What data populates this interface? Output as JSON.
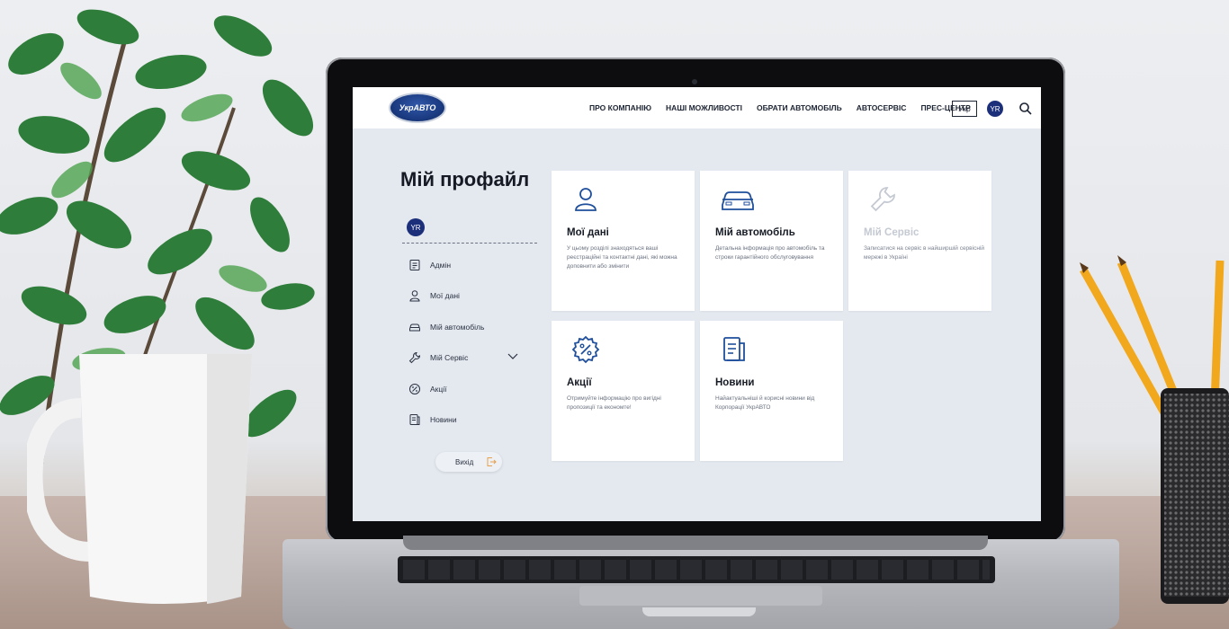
{
  "logo": {
    "text": "УкрАВТО"
  },
  "nav": {
    "items": [
      "ПРО КОМПАНІЮ",
      "НАШІ МОЖЛИВОСТІ",
      "ОБРАТИ АВТОМОБІЛЬ",
      "АВТОСЕРВІС",
      "ПРЕС-ЦЕНТР"
    ]
  },
  "header": {
    "lang": "Укр",
    "avatar": "YR"
  },
  "profile": {
    "title": "Мій профайл",
    "avatar": "YR",
    "menu": [
      {
        "label": "Адмін",
        "icon": "document-icon"
      },
      {
        "label": "Мої дані",
        "icon": "user-icon"
      },
      {
        "label": "Мій автомобіль",
        "icon": "car-icon"
      },
      {
        "label": "Мій Сервіс",
        "icon": "wrench-icon"
      },
      {
        "label": "Акції",
        "icon": "percent-icon"
      },
      {
        "label": "Новини",
        "icon": "news-icon"
      }
    ],
    "exit_label": "Вихід"
  },
  "cards": [
    {
      "title": "Мої дані",
      "desc": "У цьому розділі знаходяться ваші реєстраційні та контактні дані, які можна доповнити або змінити",
      "icon": "user-icon"
    },
    {
      "title": "Мій автомобіль",
      "desc": "Детальна інформація про автомобіль та строки гарантійного обслуговування",
      "icon": "car-icon"
    },
    {
      "title": "Мій Сервіс",
      "desc": "Записатися на сервіс в найширшій сервісній мережі в Україні",
      "icon": "wrench-icon"
    },
    {
      "title": "Акції",
      "desc": "Отримуйте інформацію про вигідні пропозиції та економте!",
      "icon": "percent-icon"
    },
    {
      "title": "Новини",
      "desc": "Найактуальніші й корисні новини від Корпорації УкрАВТО",
      "icon": "news-icon"
    }
  ],
  "colors": {
    "accent": "#1c2f7a",
    "icon_blue": "#1f4f9c",
    "screen_bg": "#e4e9f0"
  }
}
